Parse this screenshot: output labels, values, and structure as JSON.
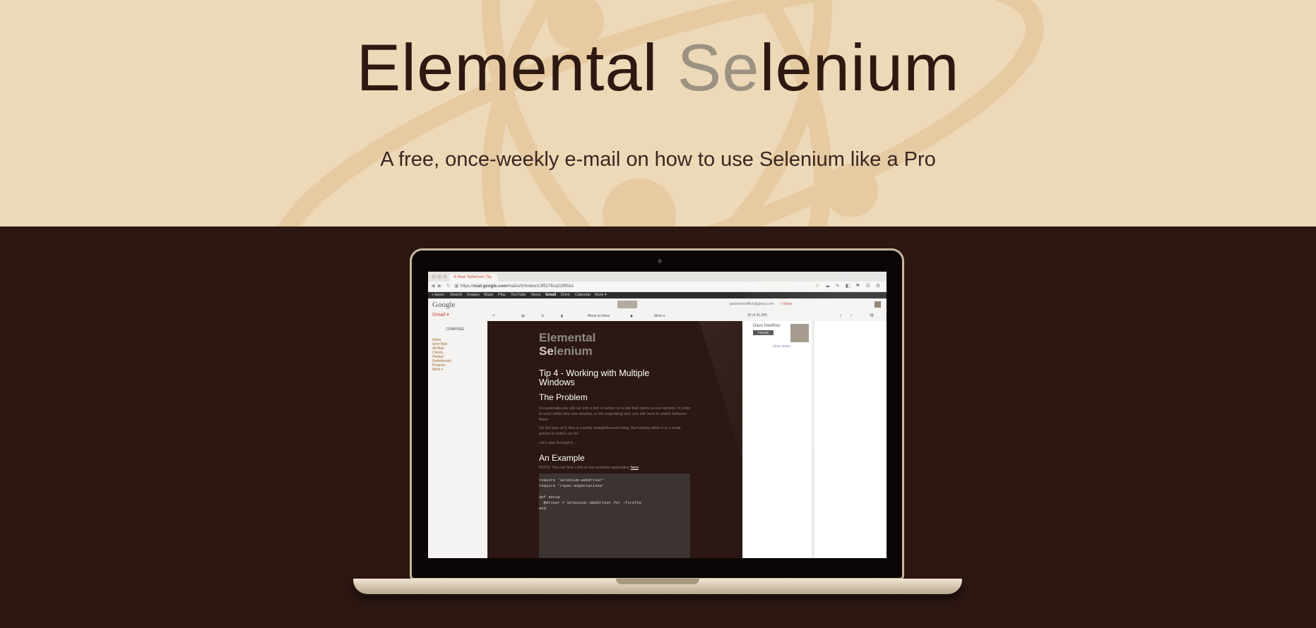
{
  "hero": {
    "title_part1": "Elemental ",
    "title_highlight": "Se",
    "title_part2": "lenium",
    "subtitle": "A free, once-weekly e-mail on how to use Selenium like a Pro"
  },
  "colors": {
    "hero_bg": "#edd9b8",
    "dark_bg": "#2d1712",
    "title_text": "#2e1812",
    "title_highlight": "#9c9282",
    "atom_watermark": "#e6caa2"
  },
  "browser": {
    "tab_title": "A New Selenium Tip",
    "url_prefix": "https://",
    "url_domain": "mail.google.com",
    "url_path": "/mail/u/0/#inbox/13f5276ca22955e1",
    "toolbar_icons": [
      "back-icon",
      "forward-icon",
      "reload-icon",
      "star-icon",
      "settings-icon"
    ]
  },
  "google_bar": [
    "+Jason",
    "Search",
    "Images",
    "Maps",
    "Play",
    "YouTube",
    "News",
    "Gmail",
    "Drive",
    "Calendar",
    "More ▾"
  ],
  "gmail": {
    "logo": "Google",
    "label": "Gmail ▾",
    "account": "jasonmoseffitch@gmail.com",
    "share": "+ Share",
    "compose": "COMPOSE",
    "toolbar": {
      "move_to_inbox": "Move to Inbox",
      "more": "More ▾",
      "pager": "20 of 30,289"
    },
    "nav_items": [
      "Inbox",
      "Sent Mail",
      "All Mail",
      "Clients",
      "Hosted",
      "Nodefounds",
      "Projects",
      "More ▾"
    ]
  },
  "email": {
    "logo_line1": "Elemental",
    "logo_se": "Se",
    "logo_rest": "lenium",
    "tip_title": "Tip 4 - Working with Multiple Windows",
    "section1": "The Problem",
    "p1": "Occasionally you will run into a link or action on a site that opens a new window. In order to work within this new window, or the originating one, you will need to switch between them.",
    "p2": "On the face of it, this is a pretty straightforward thing. But lurking within it is a small gotcha to watch out for.",
    "p3": "Let's step through it.",
    "section2": "An Example",
    "note": "NOTE: You can find a link to our example application ",
    "note_link": "here",
    "code": [
      "require 'selenium-webdriver'",
      "require 'rspec-expectations'",
      "",
      "def setup",
      "  @driver = Selenium::WebDriver.for :firefox",
      "end"
    ]
  },
  "contact": {
    "name": "Dave Haeffner",
    "badge": "Friends",
    "show_details": "Show details"
  }
}
